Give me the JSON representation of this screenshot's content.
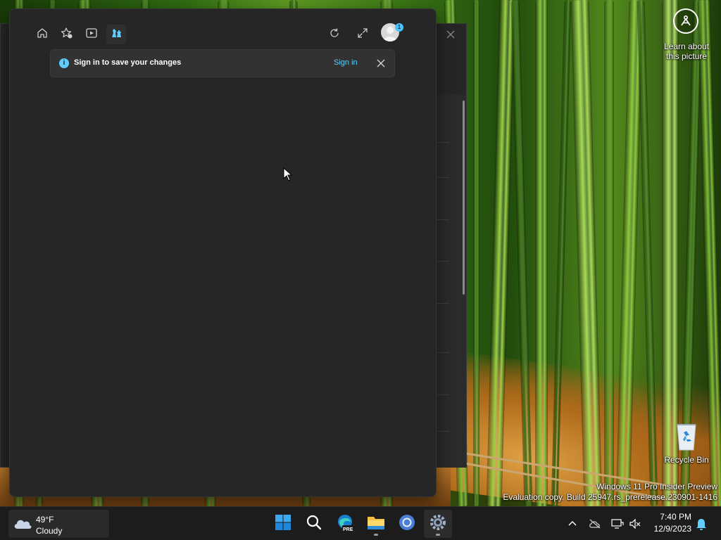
{
  "desktop": {
    "learn_label_line1": "Learn about",
    "learn_label_line2": "this picture",
    "recycle_bin_label": "Recycle Bin",
    "watermark_line1": "Windows 11 Pro Insider Preview",
    "watermark_line2": "Evaluation copy. Build 25947.rs_prerelease.230901-1416"
  },
  "panel": {
    "toolbar": {
      "icons": [
        "home-icon",
        "favorites-icon",
        "video-play-icon",
        "game-chess-icon"
      ],
      "active_tab": "game-chess-icon",
      "right_icons": [
        "refresh-icon",
        "expand-icon"
      ],
      "avatar_badge": "1"
    },
    "infobar": {
      "message": "Sign in to save your changes",
      "action": "Sign in"
    }
  },
  "taskbar": {
    "weather": {
      "temp": "49°F",
      "condition": "Cloudy"
    },
    "apps": [
      "start-icon",
      "search-icon",
      "edge-preview-icon",
      "file-explorer-icon",
      "chrome-icon",
      "settings-icon"
    ],
    "edge_badge": "PRE",
    "tray_icons": [
      "chevron-up-icon",
      "onedrive-offline-icon",
      "network-icon",
      "volume-muted-icon",
      "notification-bell-icon"
    ],
    "clock": {
      "time": "7:40 PM",
      "date": "12/9/2023"
    }
  },
  "colors": {
    "accent": "#60cdff",
    "panel_bg": "#262626",
    "taskbar_bg": "#1c1c1c"
  }
}
